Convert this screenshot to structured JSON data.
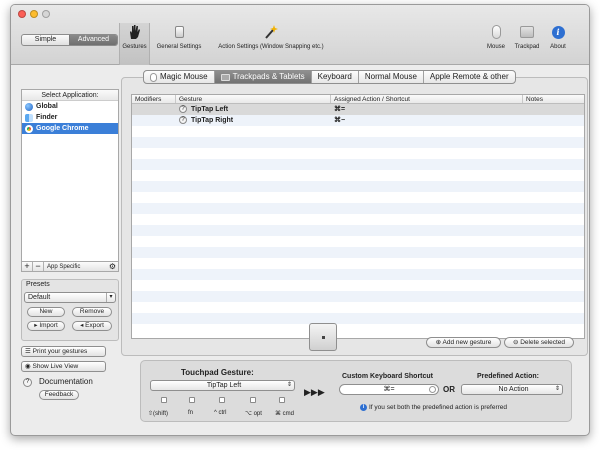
{
  "toolbar": {
    "mode_simple": "Simple",
    "mode_advanced": "Advanced",
    "items": {
      "gestures": "Gestures",
      "general": "General Settings",
      "action": "Action Settings (Window Snapping etc.)",
      "mouse": "Mouse",
      "trackpad": "Trackpad",
      "about": "About"
    }
  },
  "sidebar": {
    "header": "Select Application:",
    "apps": [
      {
        "name": "Global",
        "icon": "globe-icon"
      },
      {
        "name": "Finder",
        "icon": "finder-icon"
      },
      {
        "name": "Google Chrome",
        "icon": "chrome-icon"
      }
    ],
    "add": "+",
    "remove": "−",
    "app_specific": "App Specific",
    "presets_title": "Presets",
    "preset_value": "Default",
    "new": "New",
    "remove_btn": "Remove",
    "import": "Import",
    "export": "Export",
    "print": "Print your gestures",
    "live_view": "Show Live View",
    "documentation": "Documentation",
    "feedback": "Feedback"
  },
  "tabs": [
    {
      "label": "Magic Mouse"
    },
    {
      "label": "Trackpads & Tablets"
    },
    {
      "label": "Keyboard"
    },
    {
      "label": "Normal Mouse"
    },
    {
      "label": "Apple Remote & other"
    }
  ],
  "table": {
    "columns": [
      "Modifiers",
      "Gesture",
      "Assigned Action / Shortcut",
      "Notes"
    ],
    "rows": [
      {
        "gesture": "TipTap Left",
        "shortcut": "⌘="
      },
      {
        "gesture": "TipTap Right",
        "shortcut": "⌘−"
      }
    ]
  },
  "actions": {
    "add_gesture": "Add new gesture",
    "delete_selected": "Delete selected"
  },
  "bottom": {
    "touchpad_title": "Touchpad Gesture:",
    "touchpad_value": "TipTap Left",
    "modifiers": [
      "⇧(shift)",
      "fn",
      "^ ctrl",
      "⌥ opt",
      "⌘ cmd"
    ],
    "arrows": "▶▶▶",
    "shortcut_title": "Custom Keyboard Shortcut",
    "shortcut_value": "⌘=",
    "or": "OR",
    "predefined_title": "Predefined Action:",
    "predefined_value": "No Action",
    "info": "If you set both the predefined action is preferred"
  },
  "colors": {
    "selection": "#3b7fd8",
    "accent_tab": "#7a7a7a"
  }
}
